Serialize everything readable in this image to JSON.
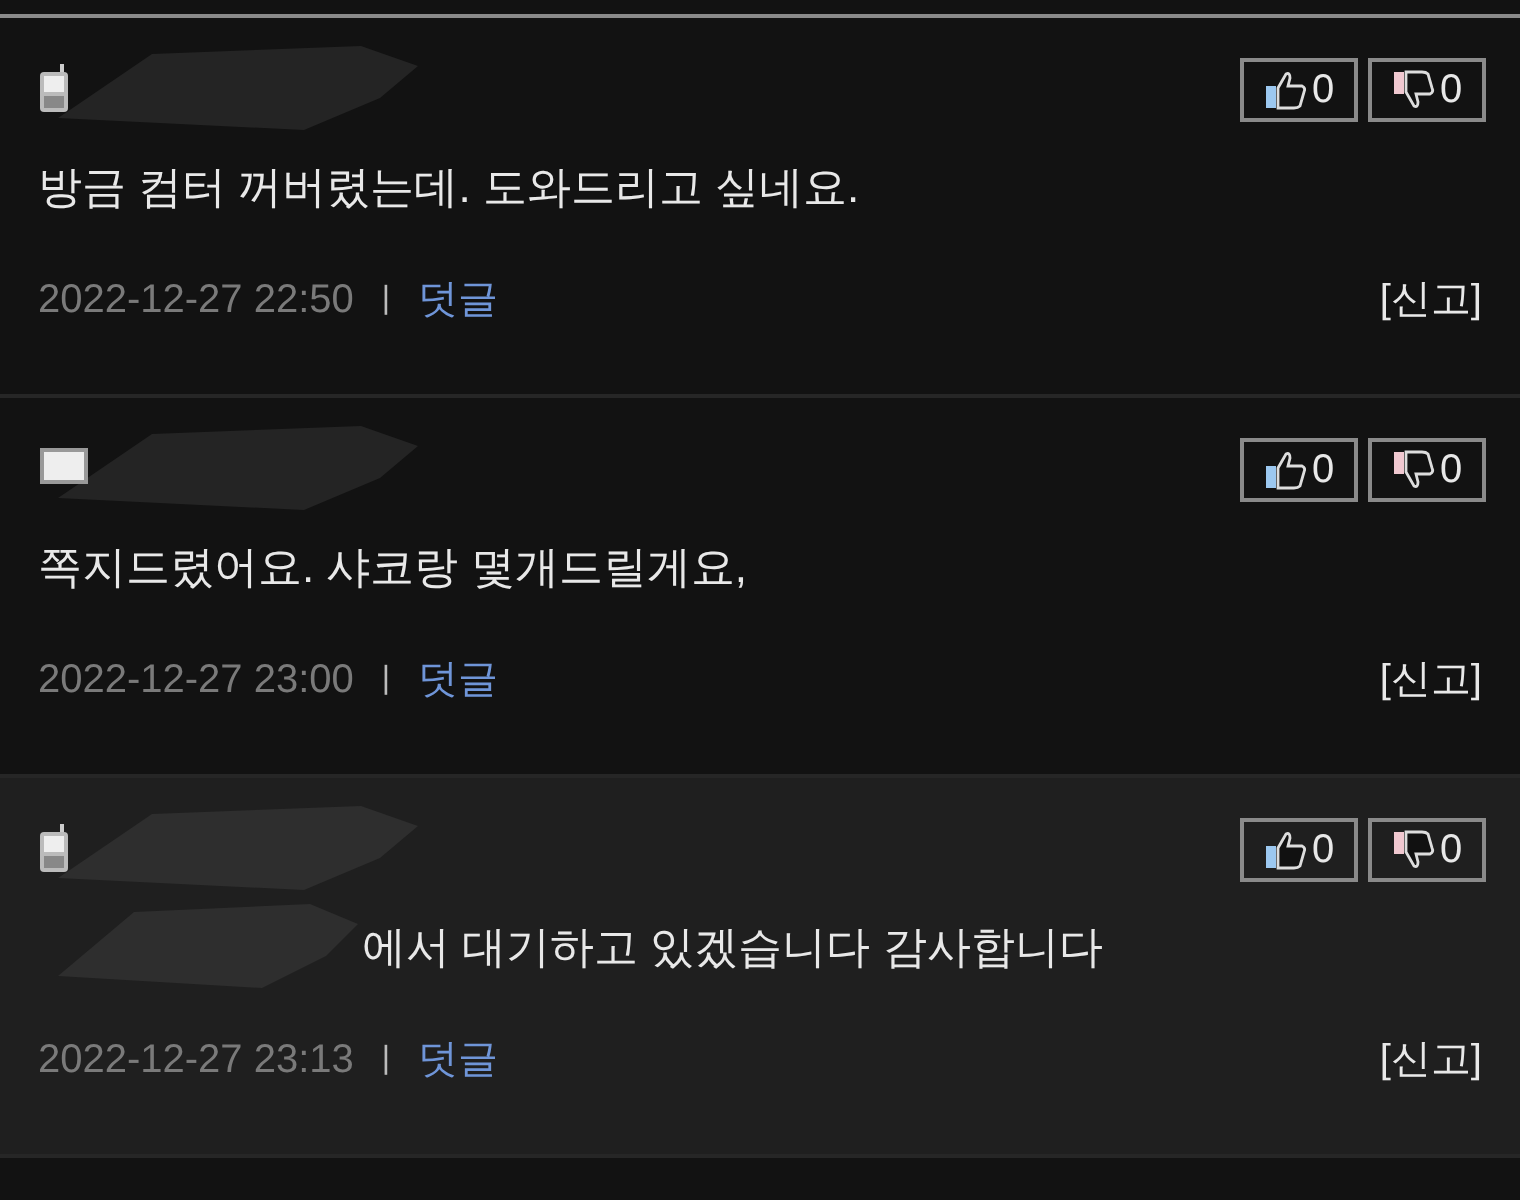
{
  "comments": [
    {
      "kind": "phone",
      "highlighted": false,
      "redacted_prefix": false,
      "text": "방금 컴터 꺼버렸는데. 도와드리고 싶네요.",
      "likes": "0",
      "dislikes": "0",
      "date": "2022-12-27 22:50",
      "separator": "|",
      "reply": "덧글",
      "report": "[신고]"
    },
    {
      "kind": "monitor",
      "highlighted": false,
      "redacted_prefix": false,
      "text": "쪽지드렸어요. 샤코랑 몇개드릴게요,",
      "likes": "0",
      "dislikes": "0",
      "date": "2022-12-27 23:00",
      "separator": "|",
      "reply": "덧글",
      "report": "[신고]"
    },
    {
      "kind": "phone",
      "highlighted": true,
      "redacted_prefix": true,
      "text": "에서 대기하고 있겠습니다 감사합니다",
      "likes": "0",
      "dislikes": "0",
      "date": "2022-12-27 23:13",
      "separator": "|",
      "reply": "덧글",
      "report": "[신고]"
    }
  ]
}
